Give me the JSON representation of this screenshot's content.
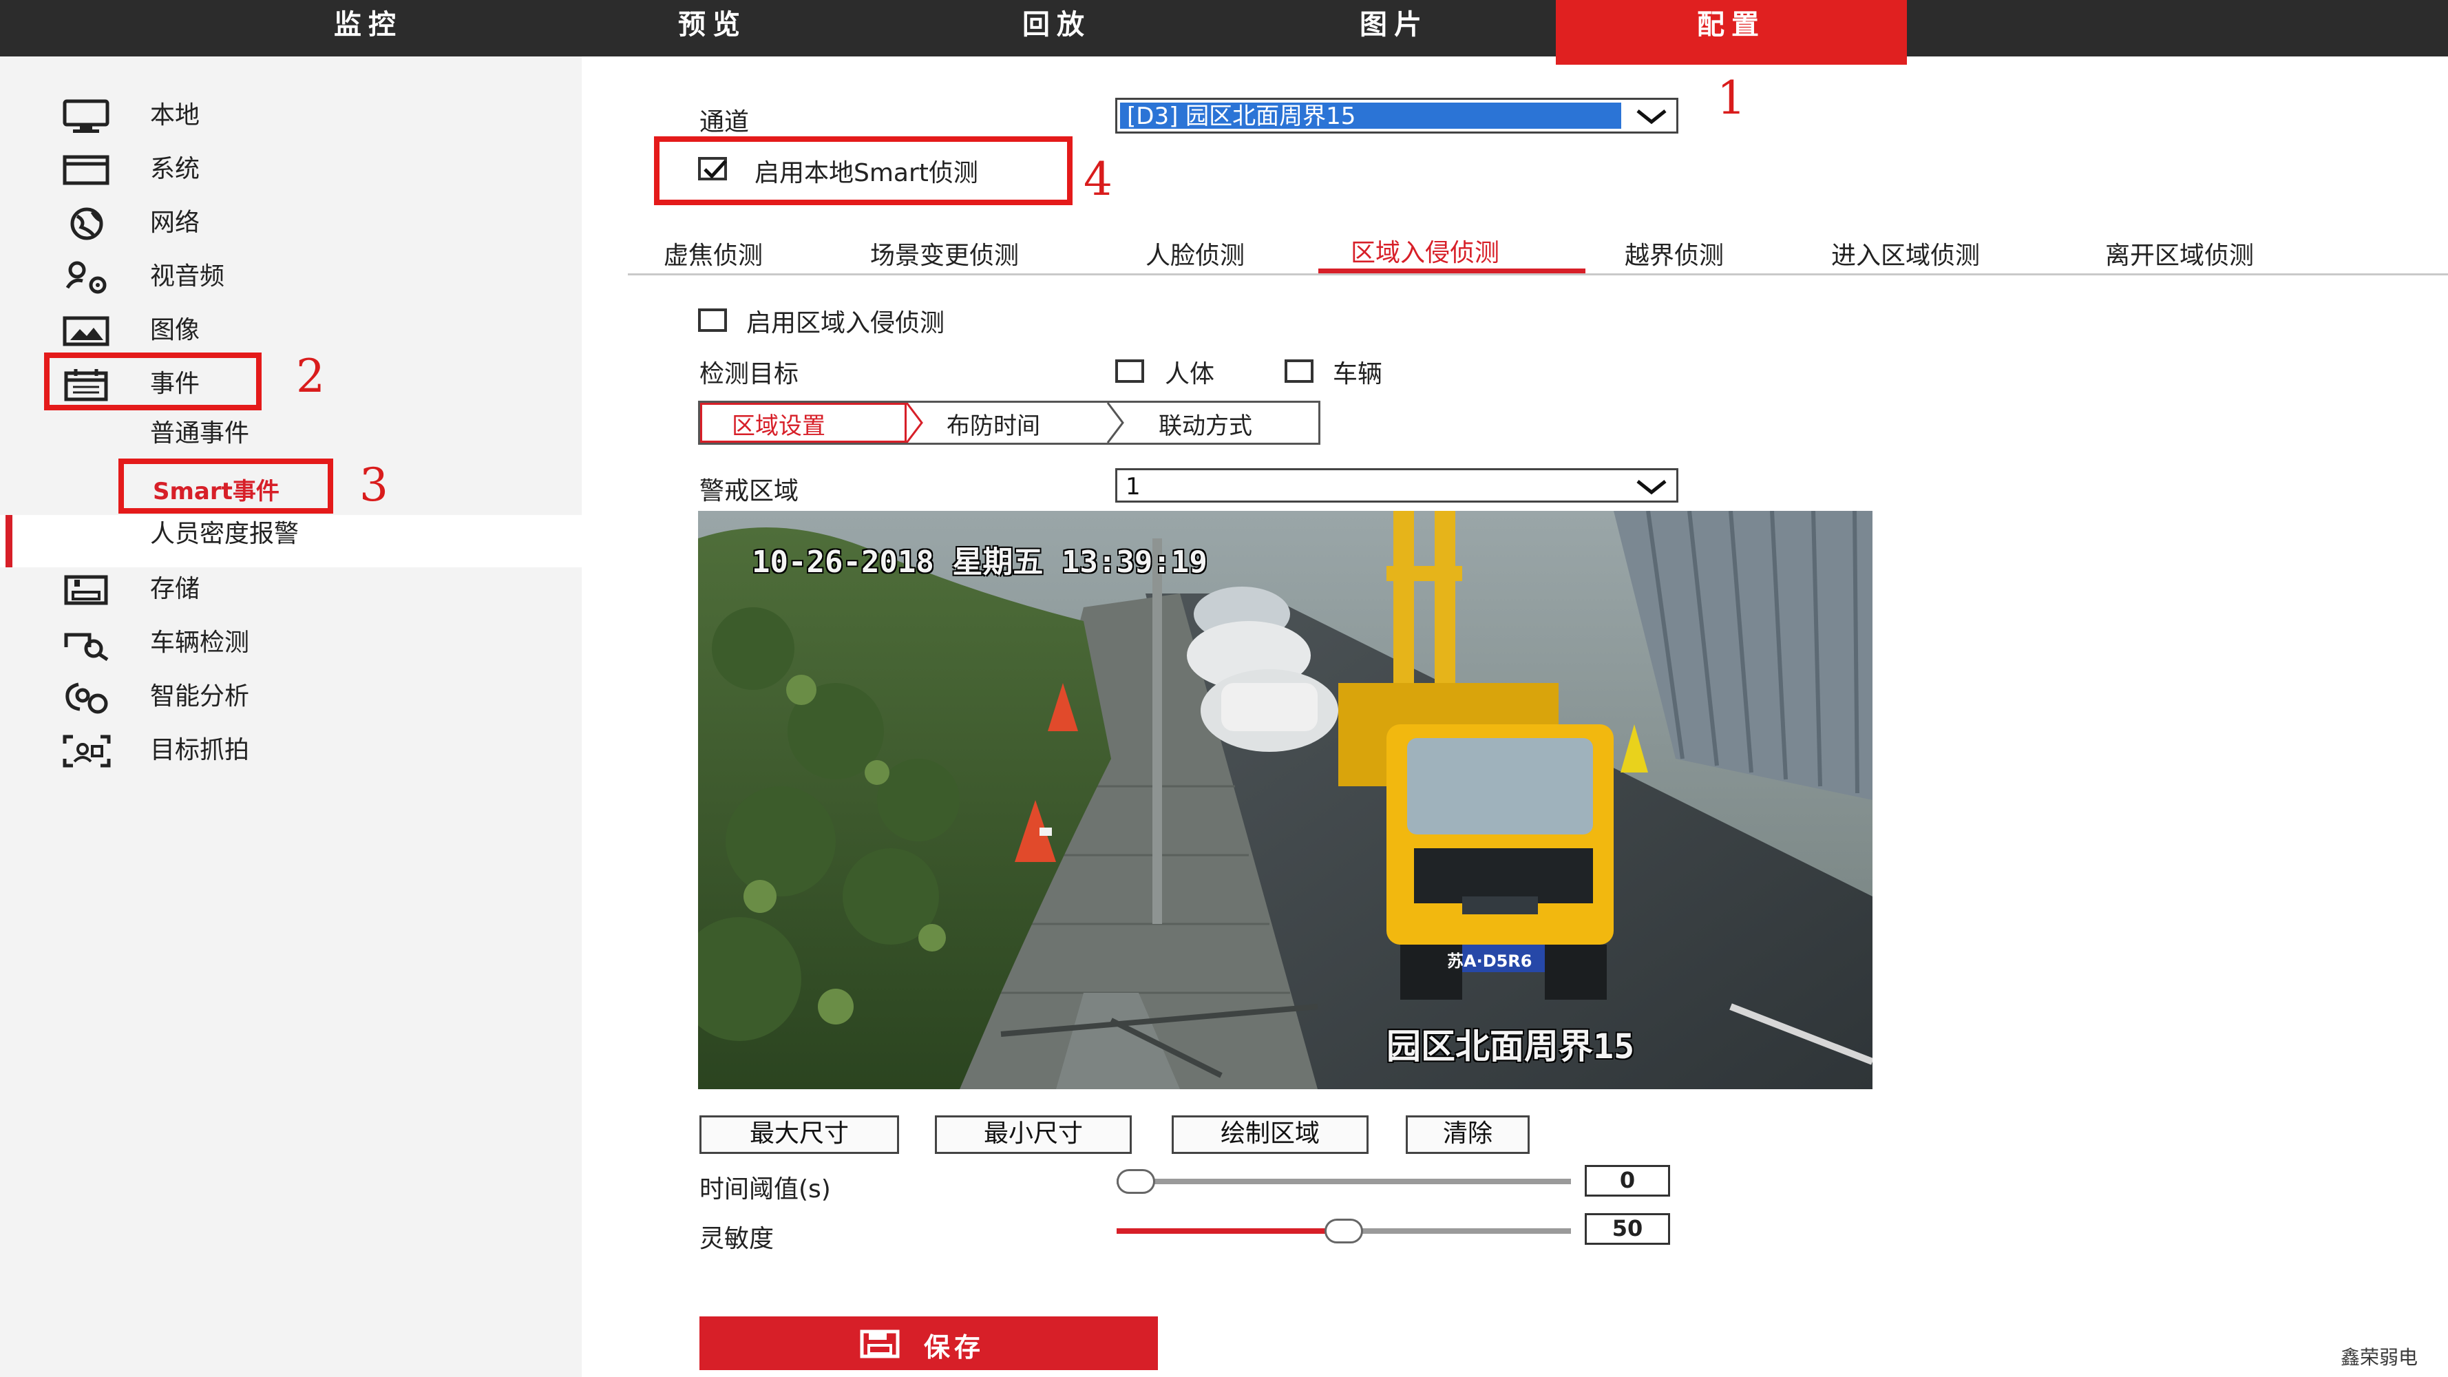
{
  "topnav": {
    "tabs": [
      {
        "label": "监控"
      },
      {
        "label": "预览"
      },
      {
        "label": "回放"
      },
      {
        "label": "图片"
      },
      {
        "label": "配置"
      }
    ]
  },
  "sidebar": {
    "items": [
      {
        "label": "本地",
        "icon": "monitor-icon"
      },
      {
        "label": "系统",
        "icon": "system-icon"
      },
      {
        "label": "网络",
        "icon": "globe-icon"
      },
      {
        "label": "视音频",
        "icon": "video-audio-icon"
      },
      {
        "label": "图像",
        "icon": "image-icon"
      },
      {
        "label": "事件",
        "icon": "calendar-icon"
      },
      {
        "label": "存储",
        "icon": "storage-icon"
      },
      {
        "label": "车辆检测",
        "icon": "vehicle-detect-icon"
      },
      {
        "label": "智能分析",
        "icon": "smart-analysis-icon"
      },
      {
        "label": "目标抓拍",
        "icon": "target-capture-icon"
      }
    ],
    "event_sub": {
      "normal": "普通事件",
      "smart": "Smart事件",
      "density": "人员密度报警"
    }
  },
  "annotations": [
    "1",
    "2",
    "3",
    "4"
  ],
  "channel": {
    "label": "通道",
    "value": "[D3] 园区北面周界15"
  },
  "enable_smart": {
    "label": "启用本地Smart侦测",
    "checked": true
  },
  "detection_tabs": [
    {
      "label": "虚焦侦测"
    },
    {
      "label": "场景变更侦测"
    },
    {
      "label": "人脸侦测"
    },
    {
      "label": "区域入侵侦测",
      "active": true
    },
    {
      "label": "越界侦测"
    },
    {
      "label": "进入区域侦测"
    },
    {
      "label": "离开区域侦测"
    }
  ],
  "enable_intrusion": {
    "label": "启用区域入侵侦测",
    "checked": false
  },
  "detect_target": {
    "label": "检测目标",
    "options": [
      {
        "label": "人体",
        "checked": false
      },
      {
        "label": "车辆",
        "checked": false
      }
    ]
  },
  "steps": [
    {
      "label": "区域设置",
      "active": true
    },
    {
      "label": "布防时间"
    },
    {
      "label": "联动方式"
    }
  ],
  "warning_area": {
    "label": "警戒区域",
    "value": "1"
  },
  "video": {
    "osd_time": "10-26-2018 星期五 13:39:19",
    "osd_name": "园区北面周界15",
    "plate": "苏A·D5R6"
  },
  "buttons": {
    "max_size": "最大尺寸",
    "min_size": "最小尺寸",
    "draw_area": "绘制区域",
    "clear": "清除"
  },
  "threshold": {
    "label": "时间阈值(s)",
    "value": "0",
    "fraction": 0.0
  },
  "sensitivity": {
    "label": "灵敏度",
    "value": "50",
    "fraction": 0.5
  },
  "save": {
    "label": "保存"
  },
  "watermark": "鑫荣弱电",
  "colors": {
    "accent": "#d71f28",
    "topbar": "#2c2c2c",
    "select_highlight": "#2b74d6"
  }
}
